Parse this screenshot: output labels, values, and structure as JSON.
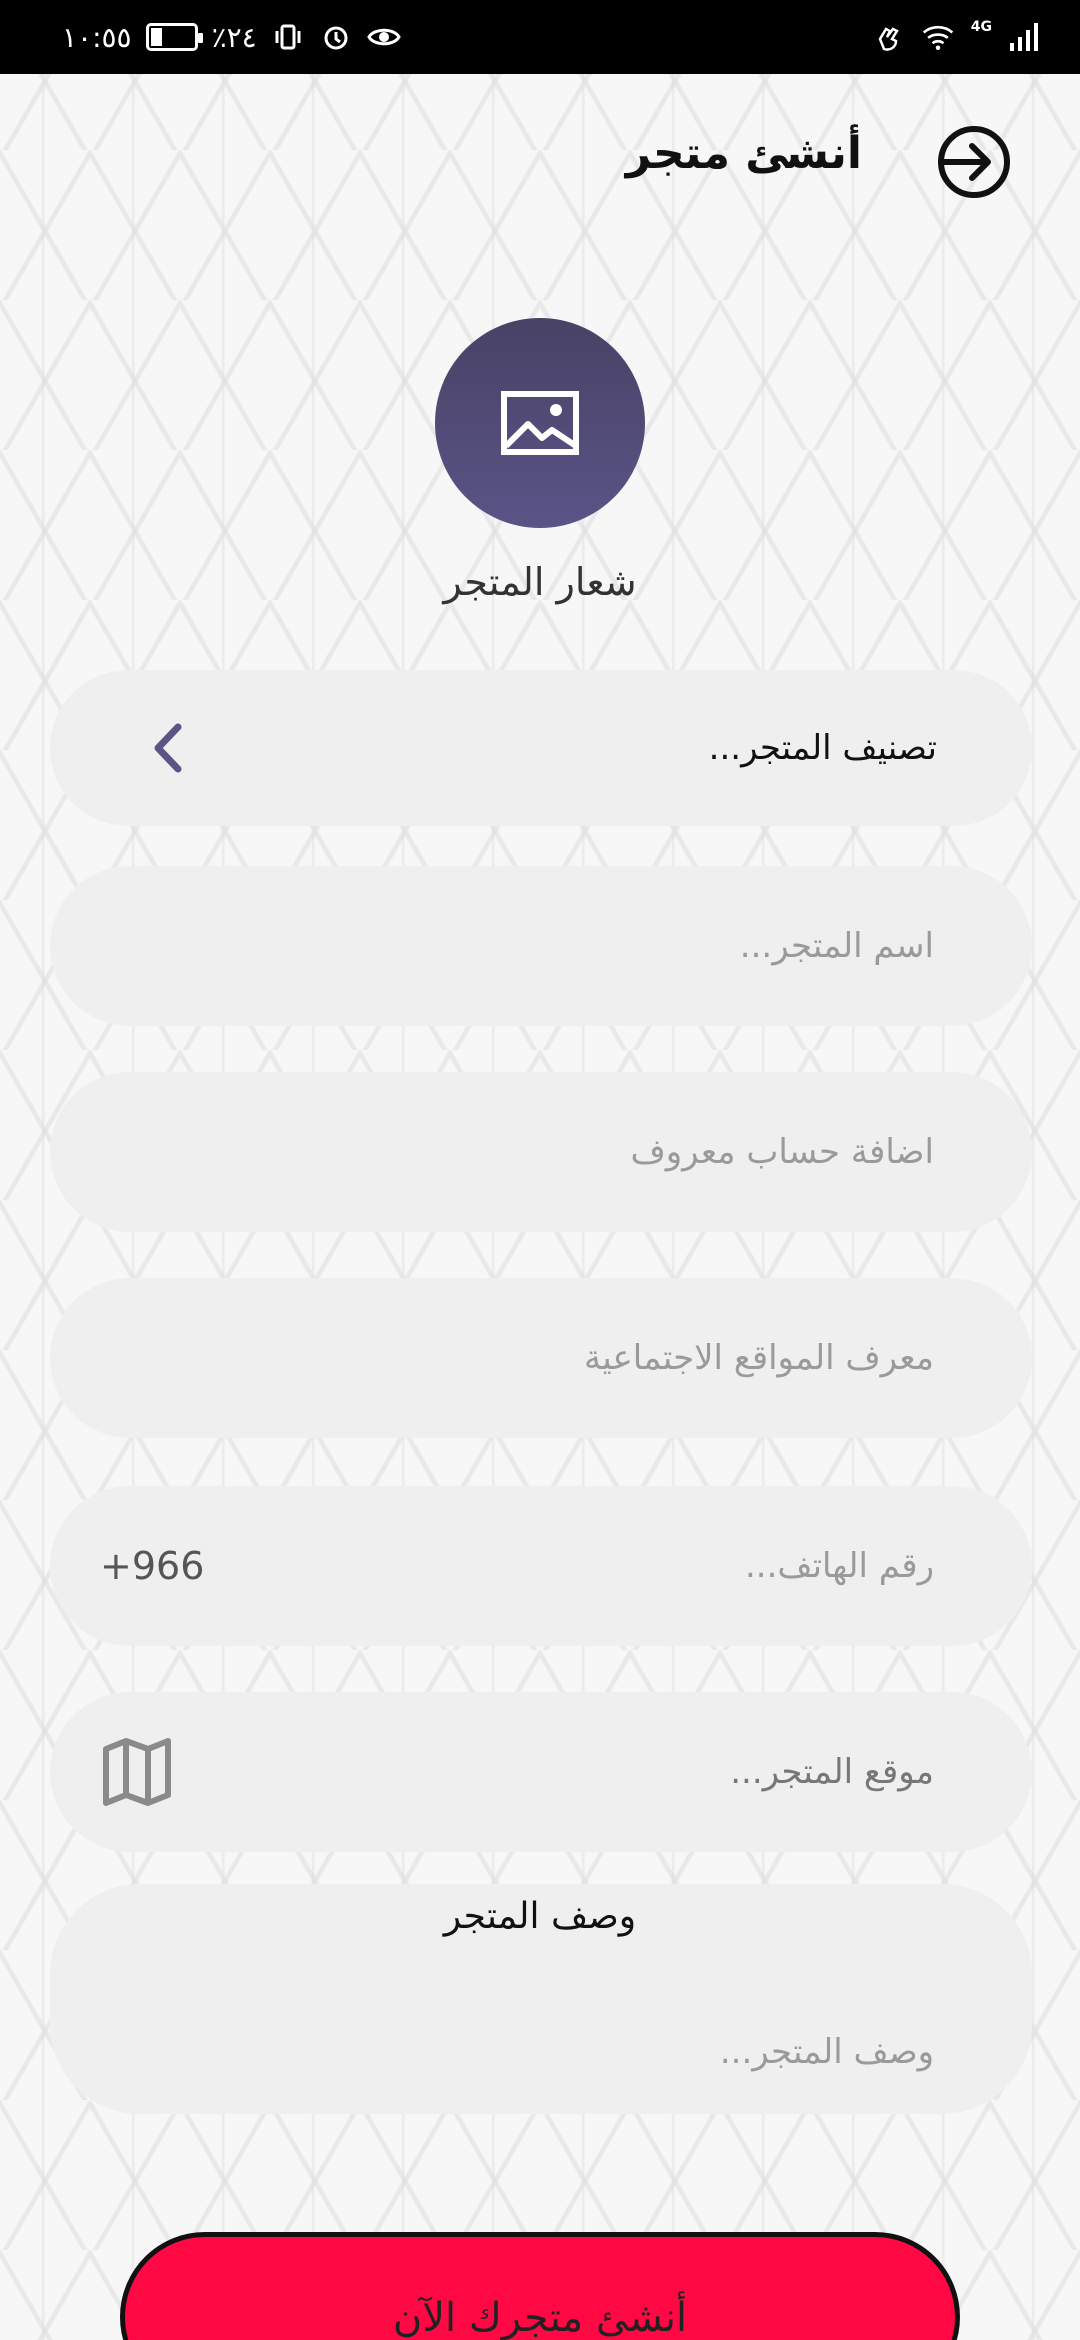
{
  "status_bar": {
    "time": "١٠:٥٥",
    "battery": "٪٢٤",
    "network": "4G"
  },
  "header": {
    "title": "أنشئ متجر"
  },
  "logo": {
    "label": "شعار المتجر"
  },
  "form": {
    "category": {
      "label": "تصنيف المتجر..."
    },
    "store_name": {
      "placeholder": "اسم المتجر..."
    },
    "known_account": {
      "placeholder": "اضافة حساب معروف"
    },
    "social_id": {
      "placeholder": "معرف المواقع الاجتماعية"
    },
    "phone": {
      "placeholder": "...رقم الهاتف",
      "country_code": "+966"
    },
    "location": {
      "placeholder": "موقع المتجر..."
    },
    "description": {
      "title": "وصف المتجر",
      "placeholder": "وصف المتجر..."
    }
  },
  "cta": {
    "label": "أنشئ متجرك الآن"
  },
  "colors": {
    "accent": "#5a5487",
    "cta": "#ff0844",
    "field_bg": "#efefef"
  },
  "icons": [
    "exit-arrow-icon",
    "image-icon",
    "chevron-left-icon",
    "map-icon"
  ]
}
